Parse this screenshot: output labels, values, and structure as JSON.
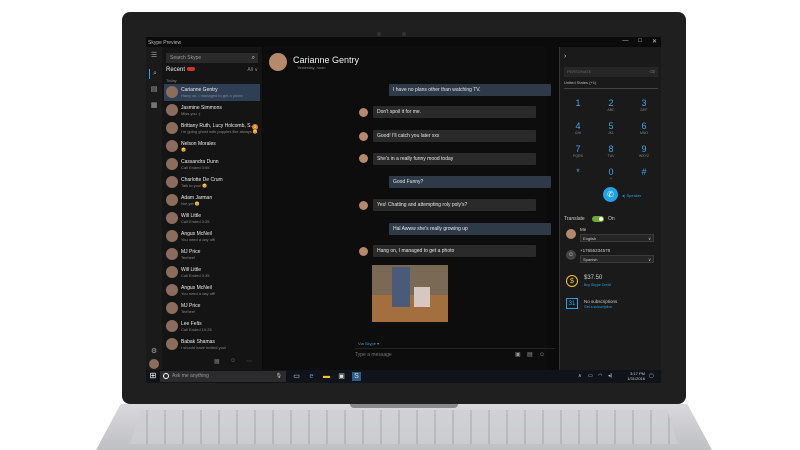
{
  "window": {
    "title": "Skype Preview",
    "controls": [
      "—",
      "□",
      "✕"
    ]
  },
  "rail": {
    "icons": [
      "menu-icon",
      "search-icon",
      "contacts-icon",
      "dialpad-icon"
    ]
  },
  "search": {
    "placeholder": "Search Skype"
  },
  "recent": {
    "label": "Recent",
    "filter": "All ∨",
    "today": "Today"
  },
  "conversations": [
    {
      "name": "Carianne Gentry",
      "preview": "Hang on, I managed to get a photo",
      "selected": true
    },
    {
      "name": "Jasmine Simmons",
      "preview": "Miss you :(",
      "selected": false
    },
    {
      "name": "Brittany Ruth, Lucy Holcomb, S...",
      "preview": "I'm going ghost with puppies like always 😊",
      "badge": "1",
      "selected": false
    },
    {
      "name": "Nelson Morales",
      "preview": "😊",
      "selected": false
    },
    {
      "name": "Cassandra Dunn",
      "preview": "Call Ended 3:55",
      "selected": false
    },
    {
      "name": "Charlotte De Crum",
      "preview": "Talk to you! 😊",
      "selected": false
    },
    {
      "name": "Adam Jarman",
      "preview": "Not yet 😊",
      "selected": false
    },
    {
      "name": "Will Little",
      "preview": "Call Ended 3:35",
      "selected": false
    },
    {
      "name": "Angus McNeil",
      "preview": "You need a day off!",
      "selected": false
    },
    {
      "name": "MJ Price",
      "preview": "Teehee!",
      "selected": false
    },
    {
      "name": "Will Little",
      "preview": "Call Ended 3:35",
      "selected": false
    },
    {
      "name": "Angus McNeil",
      "preview": "You need a day off!",
      "selected": false
    },
    {
      "name": "MJ Price",
      "preview": "Teehee!",
      "selected": false
    },
    {
      "name": "Lee Felts",
      "preview": "Call Ended 10:25",
      "selected": false
    },
    {
      "name": "Babak Shamas",
      "preview": "I should have invited you!",
      "selected": false
    }
  ],
  "chat": {
    "contact": "Carianne Gentry",
    "status": "Yesterday, noon",
    "messages": [
      {
        "text": "I have no plans other than watching TV.",
        "dir": "out"
      },
      {
        "text": "Don't spoil it for me.",
        "dir": "in"
      },
      {
        "text": "Good! I'll catch you later xxx",
        "dir": "in"
      },
      {
        "text": "She's in a really funny mood today",
        "dir": "in"
      },
      {
        "text": "Good Funny?",
        "dir": "out"
      },
      {
        "text": "Yes! Chatting and attempting roly poly's?",
        "dir": "in"
      },
      {
        "text": "Hal Awww she's really growing up",
        "dir": "out"
      },
      {
        "text": "Hang on, I managed to get a photo",
        "dir": "in"
      }
    ],
    "via": "Via",
    "via_brand": "Skype",
    "input_placeholder": "Type a message"
  },
  "dialpad": {
    "number_placeholder": "PERSONATE",
    "country": "United States (+1)",
    "keys": [
      {
        "d": "1",
        "l": ""
      },
      {
        "d": "2",
        "l": "ABC"
      },
      {
        "d": "3",
        "l": "DEF"
      },
      {
        "d": "4",
        "l": "GHI"
      },
      {
        "d": "5",
        "l": "JKL"
      },
      {
        "d": "6",
        "l": "MNO"
      },
      {
        "d": "7",
        "l": "PQRS"
      },
      {
        "d": "8",
        "l": "TUV"
      },
      {
        "d": "9",
        "l": "WXYZ"
      },
      {
        "d": "*",
        "l": ""
      },
      {
        "d": "0",
        "l": "+"
      },
      {
        "d": "#",
        "l": ""
      }
    ],
    "speaker_label": "Speaker"
  },
  "translate": {
    "label": "Translate",
    "state": "On",
    "me_label": "Me",
    "me_lang": "English",
    "other_number": "+17655234578",
    "other_lang": "Spanish"
  },
  "credit": {
    "amount": "$37.50",
    "link": "Buy Skype Credit"
  },
  "subscriptions": {
    "label": "No subscriptions",
    "link": "Get a subscription"
  },
  "taskbar": {
    "search_placeholder": "Ask me anything",
    "time": "3:17 PM",
    "date": "1/31/2016"
  },
  "colors": {
    "accent": "#1fa3e6",
    "selected": "#2e3e54",
    "toggle": "#6ea832"
  }
}
